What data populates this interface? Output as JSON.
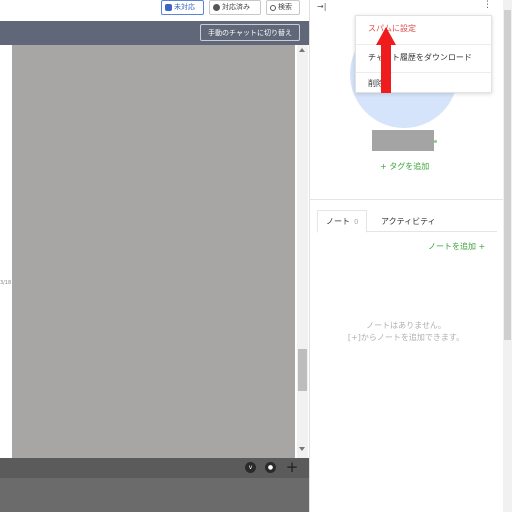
{
  "toolbar": {
    "unhandled_label": "未対応",
    "handled_label": "対応済み",
    "search_label": "検索"
  },
  "chat_header": {
    "manual_chat_label": "手動のチャットに切り替え"
  },
  "chat": {
    "side_timestamp": "3/18"
  },
  "composer": {
    "icons": [
      "v-icon",
      "chat-icon",
      "plus-icon"
    ],
    "plus_label": "+"
  },
  "right_panel": {
    "add_tag_label": "+ タグを追加",
    "tabs": [
      {
        "label": "ノート",
        "count": "0"
      },
      {
        "label": "アクティビティ"
      }
    ],
    "add_note_label": "ノートを追加 +",
    "empty_line1": "ノートはありません。",
    "empty_line2": "[+]からノートを追加できます。"
  },
  "menu": {
    "items": [
      {
        "label": "スパムに設定"
      },
      {
        "label": "チャット履歴をダウンロード"
      },
      {
        "label": "削除"
      }
    ]
  },
  "colors": {
    "accent_green": "#3aa63a",
    "spam_red": "#e04b4b",
    "arrow_red": "#ee1c1c",
    "header_gray": "#5f6778"
  }
}
